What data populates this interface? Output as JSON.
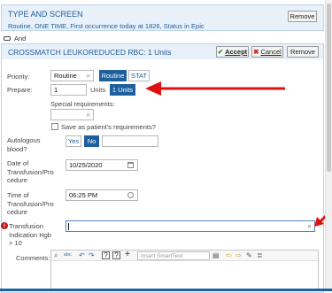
{
  "header_block": {
    "title": "TYPE AND SCREEN",
    "detail": "Routine, ONE TIME, First occurrence today at 1826, Status in Epic",
    "remove_label": "Remove"
  },
  "connector": {
    "label": "And"
  },
  "order": {
    "title": "CROSSMATCH LEUKOREDUCED RBC: 1 Units",
    "accept_label": "Accept",
    "cancel_label": "Cancel",
    "remove_label": "Remove"
  },
  "priority": {
    "label": "Priority:",
    "value": "Routine",
    "options": [
      "Routine",
      "STAT"
    ]
  },
  "prepare": {
    "label": "Prepare:",
    "value": "1",
    "unit": "Units",
    "quick_option": "1 Units"
  },
  "special": {
    "label": "Special requirements:",
    "checkbox_label": "Save as patient's requirements?"
  },
  "autologous": {
    "label_lines": [
      "Autologous",
      "blood?"
    ],
    "options": [
      "Yes",
      "No"
    ]
  },
  "date": {
    "label_lines": [
      "Date of",
      "Transfusion/Pro",
      "cedure"
    ],
    "value": "10/25/2020"
  },
  "time": {
    "label_lines": [
      "Time of",
      "Transfusion/Pro",
      "cedure"
    ],
    "value": "06:25 PM"
  },
  "indication": {
    "label_lines": [
      "Transfusion",
      "Indication Hgb",
      "> 10"
    ],
    "value": ""
  },
  "comments": {
    "label": "Comments:",
    "smarttext_placeholder": "Insert SmartText"
  },
  "colors": {
    "accent": "#1e5f9e",
    "header_bg": "#e8f1fa",
    "arrow": "#e01010"
  },
  "icons": [
    "search-icon",
    "spellcheck-icon",
    "undo-icon",
    "redo-icon",
    "help-icon",
    "add-icon",
    "calendar-icon",
    "clock-icon",
    "checkmark-icon",
    "cancel-x-icon",
    "required-icon",
    "arrow-indicator"
  ]
}
